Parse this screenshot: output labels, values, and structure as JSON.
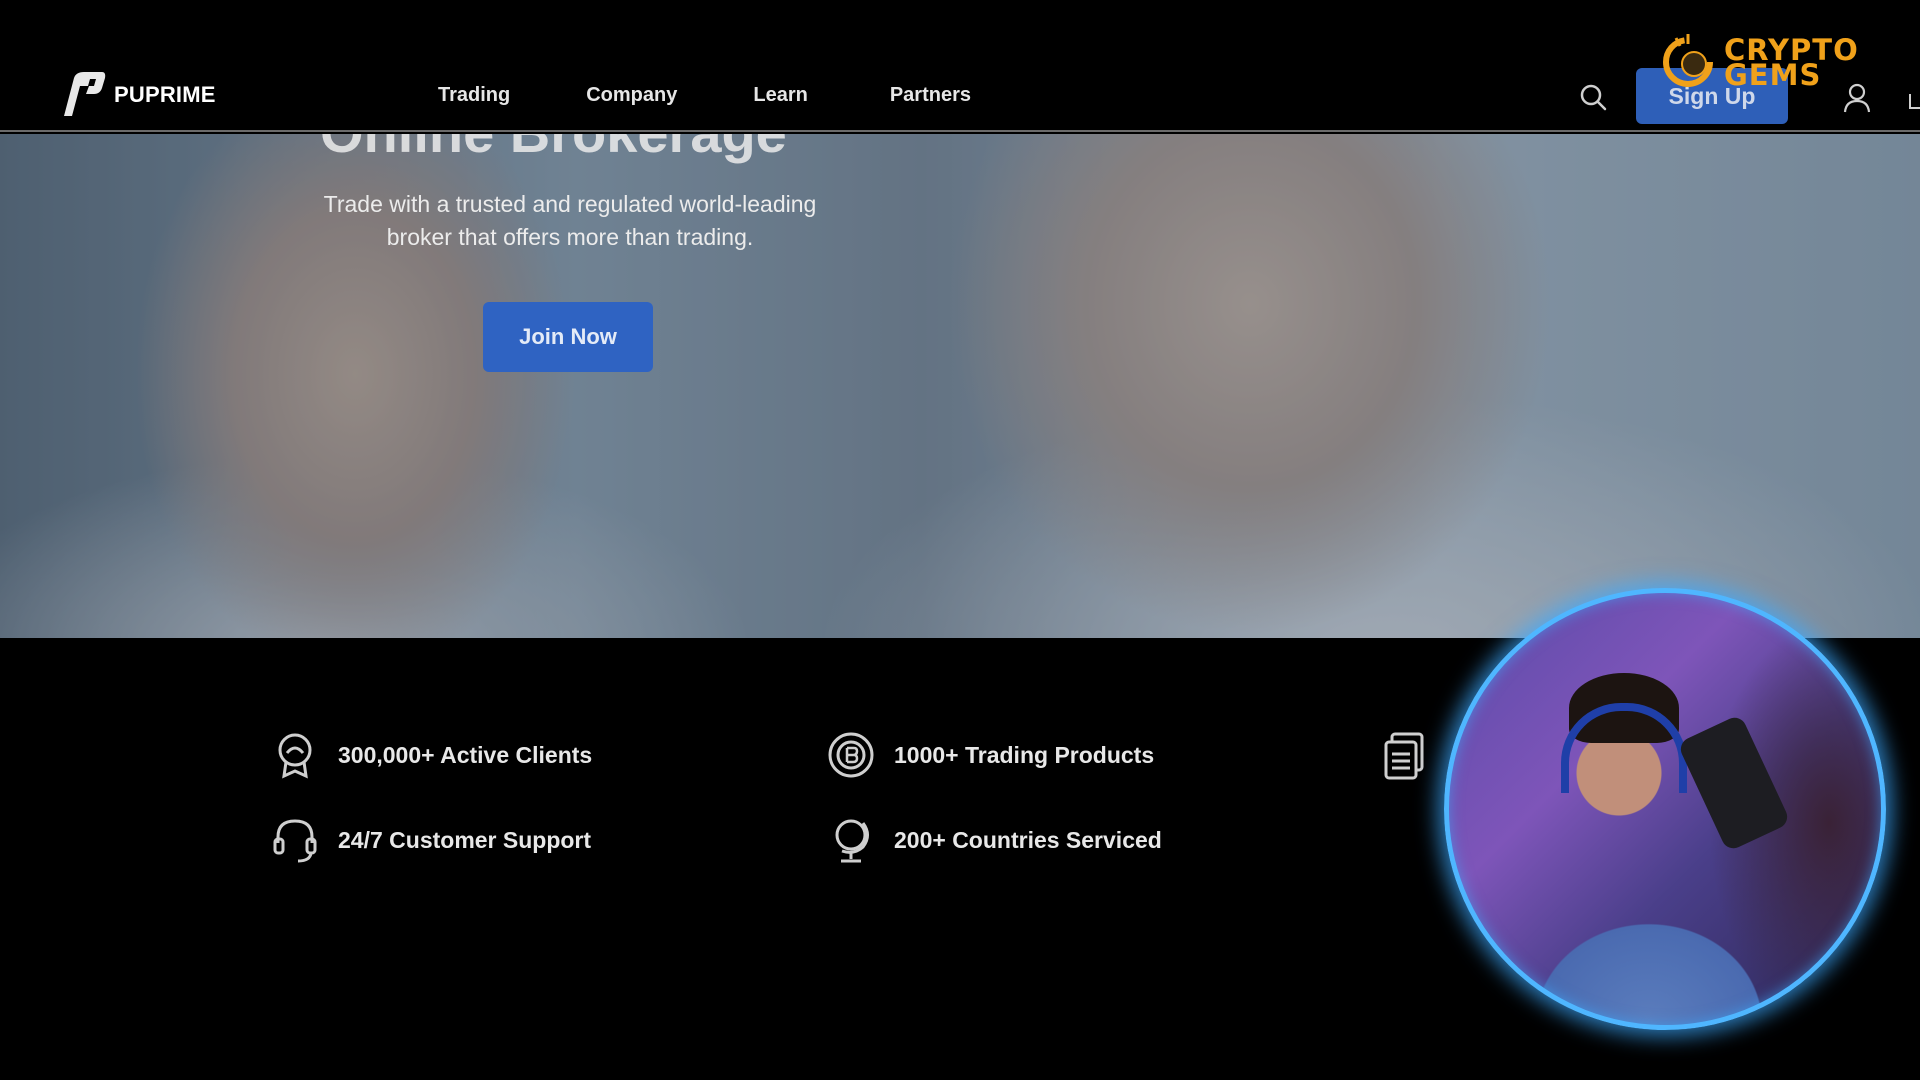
{
  "brand": {
    "name": "PUPRIME"
  },
  "nav": {
    "items": [
      "Trading",
      "Company",
      "Learn",
      "Partners"
    ],
    "signup_label": "Sign Up"
  },
  "hero": {
    "headline": "Online Brokerage",
    "subtitle": "Trade with a trusted and regulated world-leading broker that offers more than trading.",
    "cta_label": "Join Now"
  },
  "stats": [
    {
      "label": "300,000+ Active Clients",
      "icon": "award-icon"
    },
    {
      "label": "1000+ Trading Products",
      "icon": "coin-icon"
    },
    {
      "label": "24/7 Customer Support",
      "icon": "headset-icon"
    },
    {
      "label": "200+ Countries Serviced",
      "icon": "globe-icon"
    }
  ],
  "watermark": {
    "text": "CRYPTO GEMS"
  },
  "colors": {
    "accent": "#2f63c2",
    "watermark": "#f0a11a",
    "cam_ring": "#4fb6ff"
  }
}
